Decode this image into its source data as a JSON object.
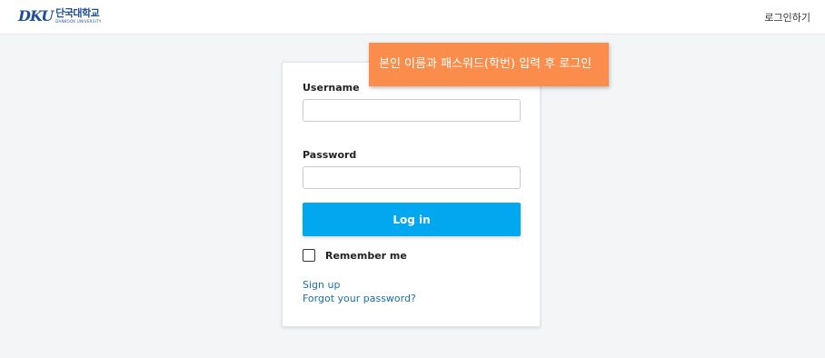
{
  "header": {
    "logo_mark": "DKU",
    "logo_korean": "단국대학교",
    "logo_english": "DANKOOK UNIVERSITY",
    "login_link": "로그인하기"
  },
  "login_form": {
    "username_label": "Username",
    "username_value": "",
    "password_label": "Password",
    "password_value": "",
    "submit_label": "Log in",
    "remember_label": "Remember me",
    "remember_checked": false,
    "signup_link": "Sign up",
    "forgot_link": "Forgot your password?"
  },
  "tooltip": {
    "text": "본인 이름과 패스워드(학번) 입력 후 로그인"
  },
  "colors": {
    "primary_button": "#01a7ef",
    "tooltip_background": "#fa8d4b",
    "link": "#1b6fa8",
    "brand": "#1d4f9a"
  }
}
